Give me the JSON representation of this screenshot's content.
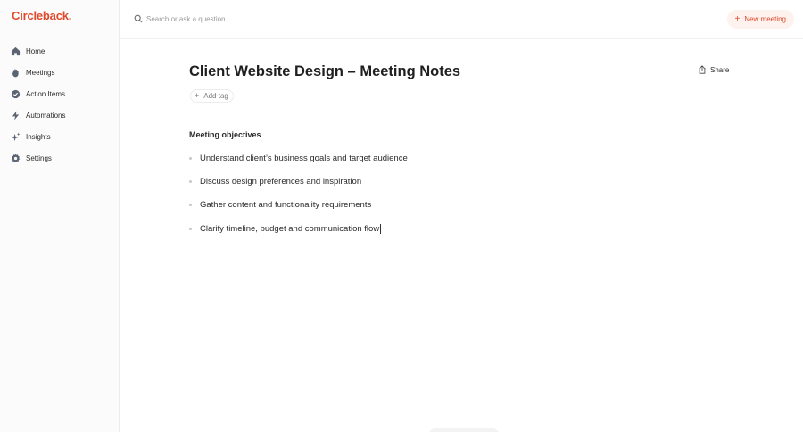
{
  "app": {
    "logo_text": "Circleback."
  },
  "sidebar": {
    "items": [
      {
        "label": "Home",
        "icon": "home-icon"
      },
      {
        "label": "Meetings",
        "icon": "hand-icon"
      },
      {
        "label": "Action Items",
        "icon": "check-circle-icon"
      },
      {
        "label": "Automations",
        "icon": "bolt-icon"
      },
      {
        "label": "Insights",
        "icon": "sparkle-icon"
      },
      {
        "label": "Settings",
        "icon": "gear-icon"
      }
    ]
  },
  "search": {
    "placeholder": "Search or ask a question..."
  },
  "toolbar": {
    "new_meeting_label": "New meeting",
    "share_label": "Share"
  },
  "page": {
    "title": "Client Website Design – Meeting Notes",
    "add_tag_label": "Add tag",
    "section_heading": "Meeting objectives",
    "objectives": [
      "Understand client’s business goals and target audience",
      "Discuss design preferences and inspiration",
      "Gather content and functionality requirements",
      "Clarify timeline, budget and communication flow"
    ]
  },
  "colors": {
    "accent": "#e0492a",
    "accent_bg": "#fdf2ee",
    "text": "#2b2b2b",
    "muted": "#9a9a9a"
  }
}
